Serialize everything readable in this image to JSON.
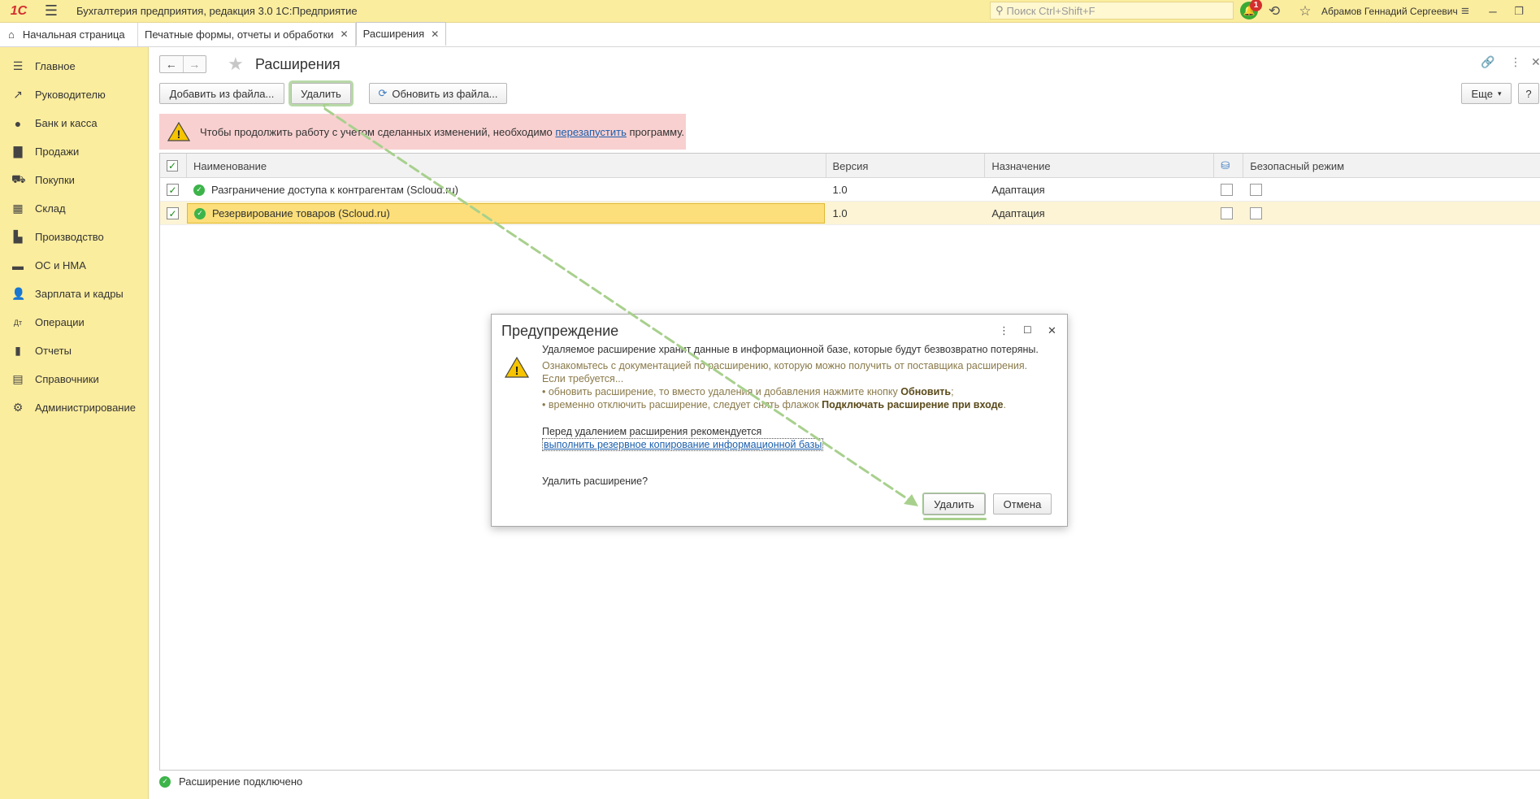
{
  "app": {
    "logo": "1С",
    "title": "Бухгалтерия предприятия, редакция 3.0 1С:Предприятие",
    "search_placeholder": "Поиск Ctrl+Shift+F",
    "notification_count": "1",
    "user": "Абрамов Геннадий Сергеевич"
  },
  "tabs": {
    "home": "Начальная страница",
    "items": [
      "Печатные формы, отчеты и обработки",
      "Расширения"
    ]
  },
  "sidebar": {
    "items": [
      {
        "label": "Главное",
        "icon": "menu-icon"
      },
      {
        "label": "Руководителю",
        "icon": "trend-icon"
      },
      {
        "label": "Банк и касса",
        "icon": "coin-icon"
      },
      {
        "label": "Продажи",
        "icon": "bag-icon"
      },
      {
        "label": "Покупки",
        "icon": "cart-icon"
      },
      {
        "label": "Склад",
        "icon": "grid-icon"
      },
      {
        "label": "Производство",
        "icon": "factory-icon"
      },
      {
        "label": "ОС и НМА",
        "icon": "truck-icon"
      },
      {
        "label": "Зарплата и кадры",
        "icon": "person-icon"
      },
      {
        "label": "Операции",
        "icon": "dtkt-icon"
      },
      {
        "label": "Отчеты",
        "icon": "bar-chart-icon"
      },
      {
        "label": "Справочники",
        "icon": "book-icon"
      },
      {
        "label": "Администрирование",
        "icon": "gear-icon"
      }
    ]
  },
  "page": {
    "title": "Расширения",
    "buttons": {
      "add_from_file": "Добавить из файла...",
      "delete": "Удалить",
      "update_from_file": "Обновить из файла...",
      "more": "Еще",
      "help": "?"
    },
    "warning": {
      "before": "Чтобы продолжить работу с учетом сделанных изменений, необходимо ",
      "link": "перезапустить",
      "after": " программу."
    }
  },
  "table": {
    "headers": {
      "name": "Наименование",
      "version": "Версия",
      "purpose": "Назначение",
      "safe_mode": "Безопасный режим"
    },
    "rows": [
      {
        "name": "Разграничение доступа к контрагентам (Scloud.ru)",
        "version": "1.0",
        "purpose": "Адаптация",
        "active": true
      },
      {
        "name": "Резервирование товаров (Scloud.ru)",
        "version": "1.0",
        "purpose": "Адаптация",
        "active": true
      }
    ]
  },
  "status": {
    "text": "Расширение подключено"
  },
  "dialog": {
    "title": "Предупреждение",
    "line1": "Удаляемое расширение хранит данные в информационной базе, которые будут безвозвратно потеряны.",
    "line2": "Ознакомьтесь с документацией по расширению, которую можно получить от поставщика расширения.",
    "line3": "Если требуется...",
    "line4_a": "• обновить расширение, то вместо удаления и добавления нажмите кнопку ",
    "line4_b": "Обновить",
    "line4_c": ";",
    "line5_a": "• временно отключить расширение, следует снять флажок ",
    "line5_b": "Подключать расширение при входе",
    "line5_c": ".",
    "line6": "Перед удалением расширения рекомендуется",
    "link": "выполнить резервное копирование информационной базы",
    "question": "Удалить расширение?",
    "ok": "Удалить",
    "cancel": "Отмена"
  },
  "colors": {
    "sidebar_bg": "#fbed9e",
    "warning_bg": "#f8d0d0",
    "selection_bg": "#fcdf7a",
    "accent_green": "#3db44a",
    "arrow_green": "#a8d08d"
  }
}
